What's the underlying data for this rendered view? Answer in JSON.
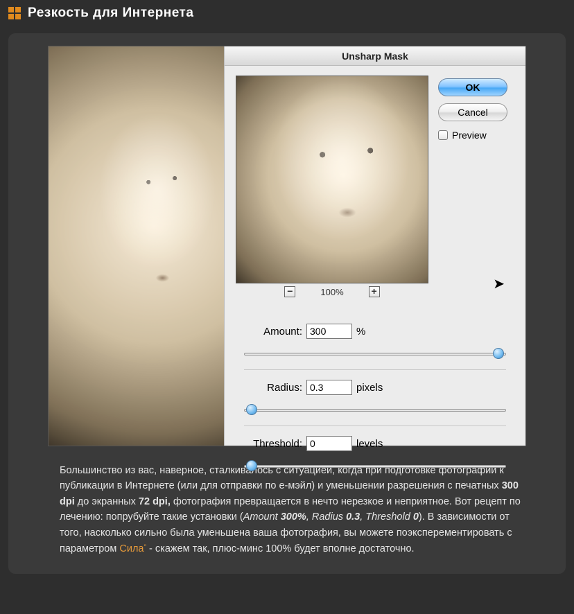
{
  "header": {
    "title": "Резкость для Интернета"
  },
  "dialog": {
    "title": "Unsharp Mask",
    "ok": "OK",
    "cancel": "Cancel",
    "preview_label": "Preview",
    "zoom": "100%",
    "params": {
      "amount": {
        "label": "Amount:",
        "value": "300",
        "unit": "%",
        "slider_pct": 97
      },
      "radius": {
        "label": "Radius:",
        "value": "0.3",
        "unit": "pixels",
        "slider_pct": 3
      },
      "threshold": {
        "label": "Threshold:",
        "value": "0",
        "unit": "levels",
        "slider_pct": 3
      }
    }
  },
  "desc": {
    "t1": "Большинство из вас, наверное, сталкивалось с ситуацией, когда при подготовке фотографии к публикации в Интернете (или для отправки по е-мэйл) и уменьшении разрешения с печатных ",
    "b1": "300 dpi",
    "t2": " до экранных ",
    "b2": "72 dpi,",
    "t3": " фотография превращается в нечто нерезкое и неприятное. Вот рецепт по лечению: попрубуйте такие установки (",
    "i1": "Amount ",
    "bi1": "300%",
    "i2": ", Radius ",
    "bi2": "0.3",
    "i3": ", Threshold ",
    "bi3": "0",
    "t4": "). В зависимости от того, насколько сильно была уменьшена ваша фотография, вы можете поэксперементировать с параметром ",
    "link": "Сила",
    "t5": " - скажем так, плюс-минс 100% будет вполне достаточно."
  }
}
